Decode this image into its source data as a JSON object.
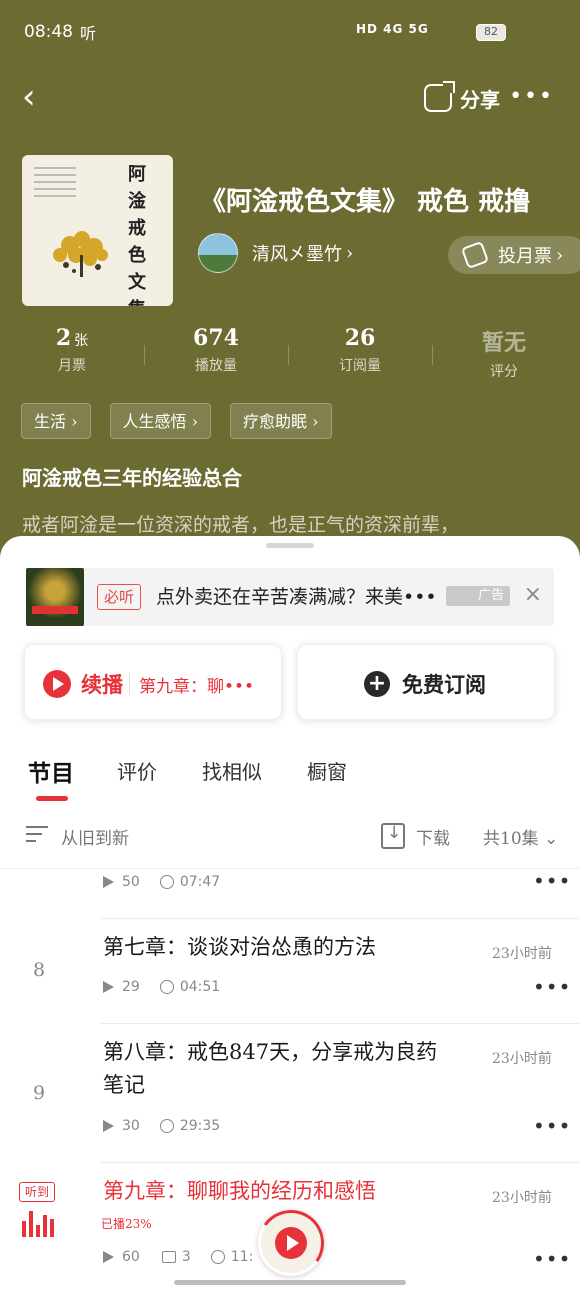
{
  "status_bar": {
    "time": "08:48",
    "left_icons": "听",
    "network": "HD 4G 5G",
    "battery": "82"
  },
  "nav": {
    "share_label": "分享",
    "more": "•••"
  },
  "album": {
    "cover_title": "阿淦戒色文集",
    "title": "《阿淦戒色文集》 戒色 戒撸",
    "author": "清风㐅墨竹",
    "vote_label": "投月票"
  },
  "stats": [
    {
      "value": "2",
      "unit": "张",
      "label": "月票"
    },
    {
      "value": "674",
      "unit": "",
      "label": "播放量"
    },
    {
      "value": "26",
      "unit": "",
      "label": "订阅量"
    },
    {
      "value": "暂无",
      "unit": "",
      "label": "评分"
    }
  ],
  "tags": [
    "生活",
    "人生感悟",
    "疗愈助眠"
  ],
  "intro": {
    "title": "阿淦戒色三年的经验总合",
    "text": "戒者阿淦是一位资深的戒者，也是正气的资深前辈，"
  },
  "ad": {
    "badge": "必听",
    "text": "点外卖还在辛苦凑满减？来美•••",
    "label": "广告"
  },
  "actions": {
    "continue_label": "续播",
    "continue_episode": "第九章：聊•••",
    "subscribe_label": "免费订阅"
  },
  "tabs": [
    "节目",
    "评价",
    "找相似",
    "橱窗"
  ],
  "toolbar": {
    "sort_label": "从旧到新",
    "download_label": "下载",
    "count_label": "共10集"
  },
  "episodes": [
    {
      "num": "",
      "title": "",
      "time": "",
      "plays": "50",
      "duration": "07:47"
    },
    {
      "num": "8",
      "title": "第七章：谈谈对治怂恿的方法",
      "time": "23小时前",
      "plays": "29",
      "duration": "04:51"
    },
    {
      "num": "9",
      "title": "第八章：戒色847天，分享戒为良药笔记",
      "time": "23小时前",
      "plays": "30",
      "duration": "29:35"
    },
    {
      "num": "",
      "title": "第九章：聊聊我的经历和感悟",
      "time": "23小时前",
      "plays": "60",
      "comments": "3",
      "duration": "11:",
      "progress": "已播23%",
      "heard_badge": "听到"
    }
  ],
  "colors": {
    "header_bg": "#6b6b32",
    "accent": "#e8323a"
  }
}
